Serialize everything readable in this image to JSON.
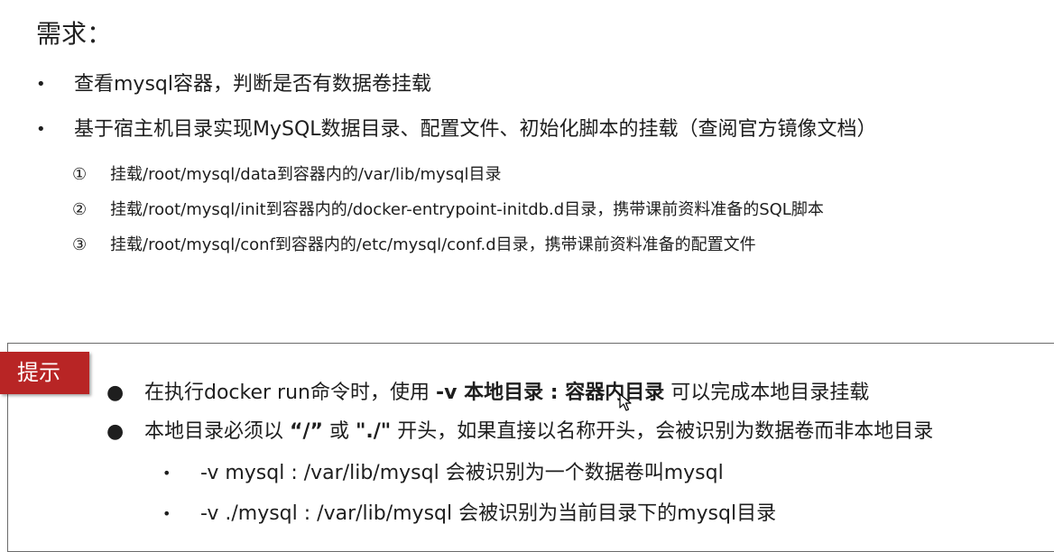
{
  "title": "需求：",
  "bullets": [
    {
      "marker": "•",
      "text": "查看mysql容器，判断是否有数据卷挂载"
    },
    {
      "marker": "•",
      "text": "基于宿主机目录实现MySQL数据目录、配置文件、初始化脚本的挂载（查阅官方镜像文档）"
    }
  ],
  "sub_items": [
    {
      "marker": "①",
      "text": "挂载/root/mysql/data到容器内的/var/lib/mysql目录"
    },
    {
      "marker": "②",
      "text": "挂载/root/mysql/init到容器内的/docker-entrypoint-initdb.d目录，携带课前资料准备的SQL脚本"
    },
    {
      "marker": "③",
      "text": "挂载/root/mysql/conf到容器内的/etc/mysql/conf.d目录，携带课前资料准备的配置文件"
    }
  ],
  "hint": {
    "label": "提示",
    "label_color": "#b82525",
    "items": [
      {
        "marker": "●",
        "prefix": "在执行docker run命令时，使用 ",
        "bold": "-v 本地目录 : 容器内目录",
        "suffix": " 可以完成本地目录挂载"
      },
      {
        "marker": "●",
        "prefix": "本地目录必须以 ",
        "bold1": "“/”",
        "middle": " 或 ",
        "bold2": "\"./\"",
        "suffix": " 开头，如果直接以名称开头，会被识别为数据卷而非本地目录"
      }
    ],
    "sub_items": [
      {
        "marker": "•",
        "text": "-v mysql : /var/lib/mysql 会被识别为一个数据卷叫mysql"
      },
      {
        "marker": "•",
        "text": "-v ./mysql : /var/lib/mysql 会被识别为当前目录下的mysql目录"
      }
    ]
  },
  "cursor_icon": "mouse-pointer-icon"
}
